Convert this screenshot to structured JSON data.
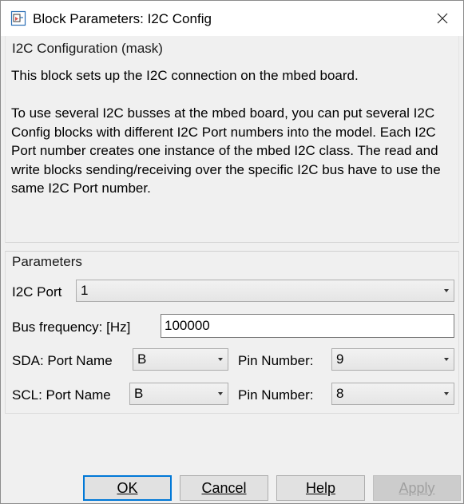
{
  "window": {
    "title": "Block Parameters: I2C Config",
    "icon": "simulink-block-icon",
    "close_icon": "close-icon"
  },
  "description": {
    "section_title": "I2C Configuration (mask)",
    "paragraph1": "This block sets up the I2C connection on the mbed board.",
    "paragraph2": "To use several I2C busses at the mbed board, you can put several I2C Config blocks with different I2C Port numbers into the model. Each I2C Port number creates one instance of the mbed I2C class. The read and write blocks sending/receiving over the specific I2C bus have to use the same I2C Port number."
  },
  "parameters": {
    "section_title": "Parameters",
    "i2c_port": {
      "label": "I2C Port",
      "value": "1"
    },
    "bus_frequency": {
      "label": "Bus frequency: [Hz]",
      "value": "100000"
    },
    "sda": {
      "port_label": "SDA: Port Name",
      "port_value": "B",
      "pin_label": "Pin Number:",
      "pin_value": "9"
    },
    "scl": {
      "port_label": "SCL: Port Name",
      "port_value": "B",
      "pin_label": "Pin Number:",
      "pin_value": "8"
    }
  },
  "buttons": {
    "ok": "OK",
    "cancel": "Cancel",
    "help": "Help",
    "apply": "Apply"
  }
}
